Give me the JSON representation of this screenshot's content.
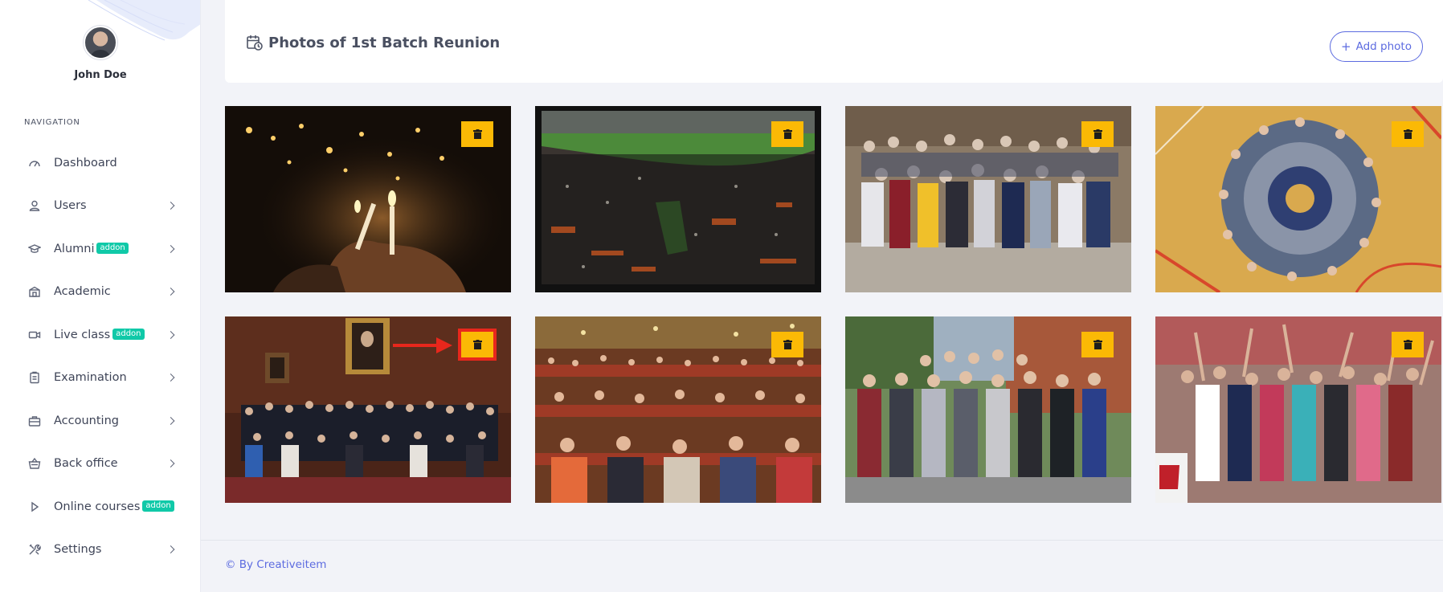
{
  "profile": {
    "name": "John Doe"
  },
  "navigation": {
    "heading": "NAVIGATION",
    "items": [
      {
        "label": "Dashboard",
        "icon": "gauge-icon",
        "badge": "",
        "has_submenu": false
      },
      {
        "label": "Users",
        "icon": "user-icon",
        "badge": "",
        "has_submenu": true
      },
      {
        "label": "Alumni",
        "icon": "graduation-cap-icon",
        "badge": "addon",
        "has_submenu": true
      },
      {
        "label": "Academic",
        "icon": "school-icon",
        "badge": "",
        "has_submenu": true
      },
      {
        "label": "Live class",
        "icon": "video-camera-icon",
        "badge": "addon",
        "has_submenu": true
      },
      {
        "label": "Examination",
        "icon": "clipboard-icon",
        "badge": "",
        "has_submenu": true
      },
      {
        "label": "Accounting",
        "icon": "briefcase-icon",
        "badge": "",
        "has_submenu": true
      },
      {
        "label": "Back office",
        "icon": "basket-icon",
        "badge": "",
        "has_submenu": true
      },
      {
        "label": "Online courses",
        "icon": "play-icon",
        "badge": "addon",
        "has_submenu": false
      },
      {
        "label": "Settings",
        "icon": "tools-icon",
        "badge": "",
        "has_submenu": true
      }
    ]
  },
  "header": {
    "title": "Photos of 1st Batch Reunion",
    "title_icon": "calendar-clock-icon",
    "add_photo_label": "Add photo",
    "add_photo_icon": "plus-icon"
  },
  "gallery": {
    "photos": [
      {
        "scene": "candlelight vigil",
        "delete_icon": "trash-icon",
        "highlighted": false
      },
      {
        "scene": "graduation ceremony crowd",
        "delete_icon": "trash-icon",
        "highlighted": false
      },
      {
        "scene": "students group on steps",
        "delete_icon": "trash-icon",
        "highlighted": false
      },
      {
        "scene": "students circle on gym floor",
        "delete_icon": "trash-icon",
        "highlighted": false
      },
      {
        "scene": "formal group portrait in library",
        "delete_icon": "trash-icon",
        "highlighted": true
      },
      {
        "scene": "auditorium audience",
        "delete_icon": "trash-icon",
        "highlighted": false
      },
      {
        "scene": "staff group outside building",
        "delete_icon": "trash-icon",
        "highlighted": false
      },
      {
        "scene": "students celebrating outdoors",
        "delete_icon": "trash-icon",
        "highlighted": false
      }
    ]
  },
  "footer": {
    "text": "© By Creativeitem"
  },
  "colors": {
    "accent": "#5c6be0",
    "badge": "#10c9a8",
    "delete_button": "#fbb905",
    "highlight": "#e8271c",
    "background": "#f2f3f8"
  }
}
